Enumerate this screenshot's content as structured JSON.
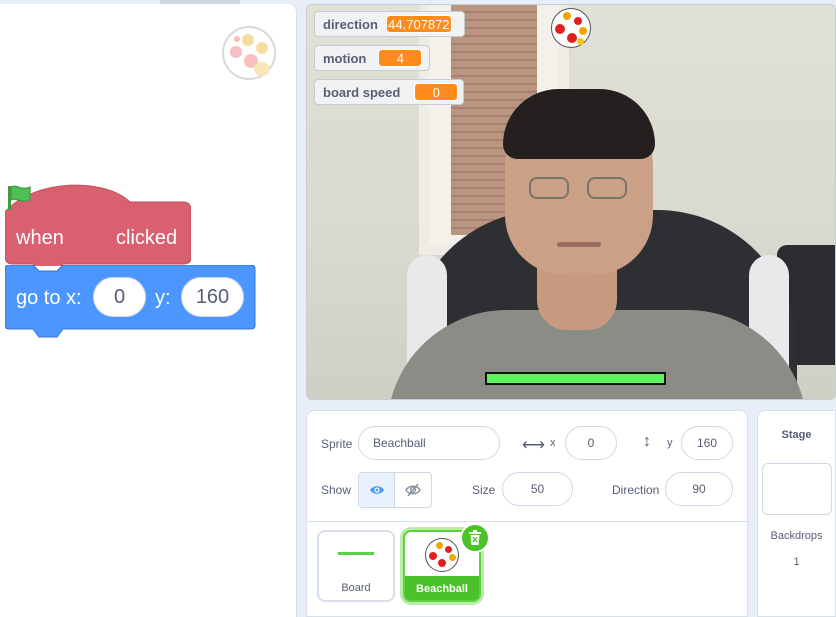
{
  "code": {
    "hat_block": {
      "word1": "when",
      "word2": "clicked",
      "color": "#d9616f"
    },
    "motion_block": {
      "label_x": "go to x:",
      "value_x": "0",
      "label_y": "y:",
      "value_y": "160",
      "color": "#4c97ff"
    }
  },
  "stage": {
    "monitors": [
      {
        "label": "direction",
        "value": "44.707872"
      },
      {
        "label": "motion",
        "value": "4"
      },
      {
        "label": "board speed",
        "value": "0"
      }
    ],
    "board_color": "#5cf55c"
  },
  "sprite_info": {
    "sprite_label": "Sprite",
    "sprite_name": "Beachball",
    "x_label": "x",
    "x_value": "0",
    "y_label": "y",
    "y_value": "160",
    "show_label": "Show",
    "size_label": "Size",
    "size_value": "50",
    "direction_label": "Direction",
    "direction_value": "90"
  },
  "sprites": [
    {
      "name": "Board",
      "selected": false
    },
    {
      "name": "Beachball",
      "selected": true
    }
  ],
  "stage_selector": {
    "title": "Stage",
    "backdrops_label": "Backdrops",
    "backdrops_count": "1"
  },
  "icons": [
    "beachball-icon",
    "green-flag-icon",
    "horizontal-arrows-icon",
    "vertical-arrows-icon",
    "eye-icon",
    "eye-slash-icon",
    "trash-icon"
  ]
}
